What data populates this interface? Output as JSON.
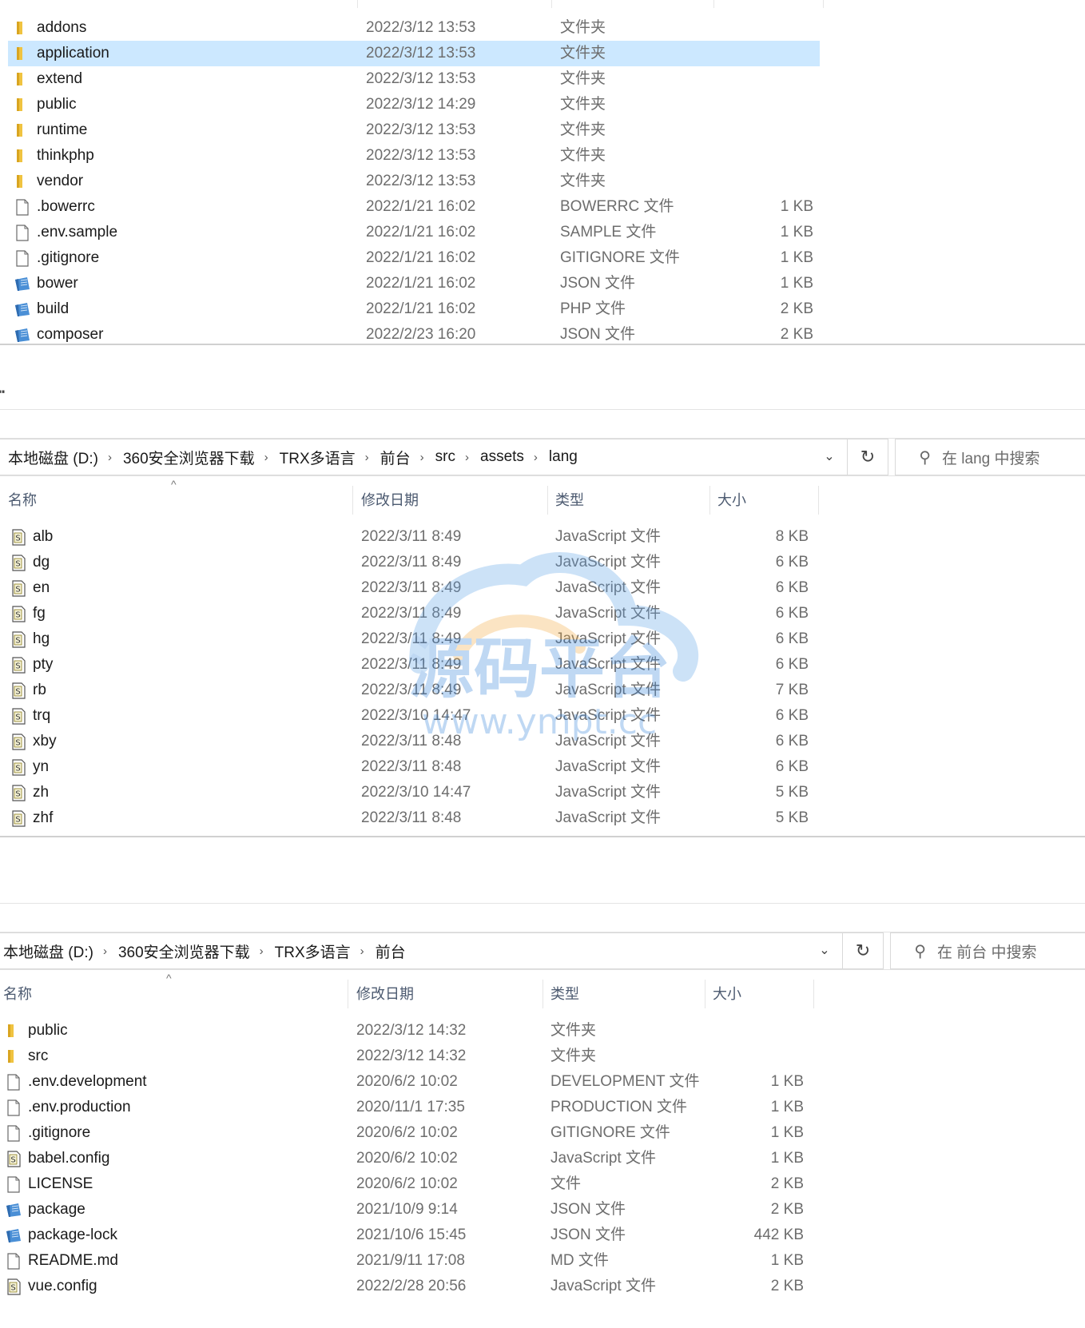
{
  "panel1": {
    "rows": [
      {
        "name": "addons",
        "date": "2022/3/12 13:53",
        "type": "文件夹",
        "size": "",
        "icon": "folder-icon",
        "selected": false
      },
      {
        "name": "application",
        "date": "2022/3/12 13:53",
        "type": "文件夹",
        "size": "",
        "icon": "folder-icon",
        "selected": true
      },
      {
        "name": "extend",
        "date": "2022/3/12 13:53",
        "type": "文件夹",
        "size": "",
        "icon": "folder-icon",
        "selected": false
      },
      {
        "name": "public",
        "date": "2022/3/12 14:29",
        "type": "文件夹",
        "size": "",
        "icon": "folder-icon",
        "selected": false
      },
      {
        "name": "runtime",
        "date": "2022/3/12 13:53",
        "type": "文件夹",
        "size": "",
        "icon": "folder-icon",
        "selected": false
      },
      {
        "name": "thinkphp",
        "date": "2022/3/12 13:53",
        "type": "文件夹",
        "size": "",
        "icon": "folder-icon",
        "selected": false
      },
      {
        "name": "vendor",
        "date": "2022/3/12 13:53",
        "type": "文件夹",
        "size": "",
        "icon": "folder-icon",
        "selected": false
      },
      {
        "name": ".bowerrc",
        "date": "2022/1/21 16:02",
        "type": "BOWERRC 文件",
        "size": "1 KB",
        "icon": "blank-file-icon",
        "selected": false
      },
      {
        "name": ".env.sample",
        "date": "2022/1/21 16:02",
        "type": "SAMPLE 文件",
        "size": "1 KB",
        "icon": "blank-file-icon",
        "selected": false
      },
      {
        "name": ".gitignore",
        "date": "2022/1/21 16:02",
        "type": "GITIGNORE 文件",
        "size": "1 KB",
        "icon": "blank-file-icon",
        "selected": false
      },
      {
        "name": "bower",
        "date": "2022/1/21 16:02",
        "type": "JSON 文件",
        "size": "1 KB",
        "icon": "json-file-icon",
        "selected": false
      },
      {
        "name": "build",
        "date": "2022/1/21 16:02",
        "type": "PHP 文件",
        "size": "2 KB",
        "icon": "json-file-icon",
        "selected": false
      },
      {
        "name": "composer",
        "date": "2022/2/23 16:20",
        "type": "JSON 文件",
        "size": "2 KB",
        "icon": "json-file-icon",
        "selected": false
      }
    ]
  },
  "panel2": {
    "breadcrumb": [
      "本地磁盘 (D:)",
      "360安全浏览器下载",
      "TRX多语言",
      "前台",
      "src",
      "assets",
      "lang"
    ],
    "search_placeholder": "在 lang 中搜索",
    "headers": {
      "name": "名称",
      "date": "修改日期",
      "type": "类型",
      "size": "大小"
    },
    "rows": [
      {
        "name": "alb",
        "date": "2022/3/11 8:49",
        "type": "JavaScript 文件",
        "size": "8 KB",
        "icon": "js-file-icon"
      },
      {
        "name": "dg",
        "date": "2022/3/11 8:49",
        "type": "JavaScript 文件",
        "size": "6 KB",
        "icon": "js-file-icon"
      },
      {
        "name": "en",
        "date": "2022/3/11 8:49",
        "type": "JavaScript 文件",
        "size": "6 KB",
        "icon": "js-file-icon"
      },
      {
        "name": "fg",
        "date": "2022/3/11 8:49",
        "type": "JavaScript 文件",
        "size": "6 KB",
        "icon": "js-file-icon"
      },
      {
        "name": "hg",
        "date": "2022/3/11 8:49",
        "type": "JavaScript 文件",
        "size": "6 KB",
        "icon": "js-file-icon"
      },
      {
        "name": "pty",
        "date": "2022/3/11 8:49",
        "type": "JavaScript 文件",
        "size": "6 KB",
        "icon": "js-file-icon"
      },
      {
        "name": "rb",
        "date": "2022/3/11 8:49",
        "type": "JavaScript 文件",
        "size": "7 KB",
        "icon": "js-file-icon"
      },
      {
        "name": "trq",
        "date": "2022/3/10 14:47",
        "type": "JavaScript 文件",
        "size": "6 KB",
        "icon": "js-file-icon"
      },
      {
        "name": "xby",
        "date": "2022/3/11 8:48",
        "type": "JavaScript 文件",
        "size": "6 KB",
        "icon": "js-file-icon"
      },
      {
        "name": "yn",
        "date": "2022/3/11 8:48",
        "type": "JavaScript 文件",
        "size": "6 KB",
        "icon": "js-file-icon"
      },
      {
        "name": "zh",
        "date": "2022/3/10 14:47",
        "type": "JavaScript 文件",
        "size": "5 KB",
        "icon": "js-file-icon"
      },
      {
        "name": "zhf",
        "date": "2022/3/11 8:48",
        "type": "JavaScript 文件",
        "size": "5 KB",
        "icon": "js-file-icon"
      }
    ]
  },
  "panel3": {
    "breadcrumb": [
      "本地磁盘 (D:)",
      "360安全浏览器下载",
      "TRX多语言",
      "前台"
    ],
    "search_placeholder": "在 前台 中搜索",
    "headers": {
      "name": "名称",
      "date": "修改日期",
      "type": "类型",
      "size": "大小"
    },
    "rows": [
      {
        "name": "public",
        "date": "2022/3/12 14:32",
        "type": "文件夹",
        "size": "",
        "icon": "folder-icon"
      },
      {
        "name": "src",
        "date": "2022/3/12 14:32",
        "type": "文件夹",
        "size": "",
        "icon": "folder-icon"
      },
      {
        "name": ".env.development",
        "date": "2020/6/2 10:02",
        "type": "DEVELOPMENT 文件",
        "size": "1 KB",
        "icon": "blank-file-icon"
      },
      {
        "name": ".env.production",
        "date": "2020/11/1 17:35",
        "type": "PRODUCTION 文件",
        "size": "1 KB",
        "icon": "blank-file-icon"
      },
      {
        "name": ".gitignore",
        "date": "2020/6/2 10:02",
        "type": "GITIGNORE 文件",
        "size": "1 KB",
        "icon": "blank-file-icon"
      },
      {
        "name": "babel.config",
        "date": "2020/6/2 10:02",
        "type": "JavaScript 文件",
        "size": "1 KB",
        "icon": "js-file-icon"
      },
      {
        "name": "LICENSE",
        "date": "2020/6/2 10:02",
        "type": "文件",
        "size": "2 KB",
        "icon": "blank-file-icon"
      },
      {
        "name": "package",
        "date": "2021/10/9 9:14",
        "type": "JSON 文件",
        "size": "2 KB",
        "icon": "json-file-icon"
      },
      {
        "name": "package-lock",
        "date": "2021/10/6 15:45",
        "type": "JSON 文件",
        "size": "442 KB",
        "icon": "json-file-icon"
      },
      {
        "name": "README.md",
        "date": "2021/9/11 17:08",
        "type": "MD 文件",
        "size": "1 KB",
        "icon": "blank-file-icon"
      },
      {
        "name": "vue.config",
        "date": "2022/2/28 20:56",
        "type": "JavaScript 文件",
        "size": "2 KB",
        "icon": "js-file-icon"
      }
    ]
  },
  "watermark": {
    "text": "源码平台",
    "url": "www.ympt.cc"
  },
  "colors": {
    "selection": "#cce8ff",
    "folder": "#f0c340",
    "json_icon": "#4a8fd6",
    "header_text": "#4c5a70"
  }
}
